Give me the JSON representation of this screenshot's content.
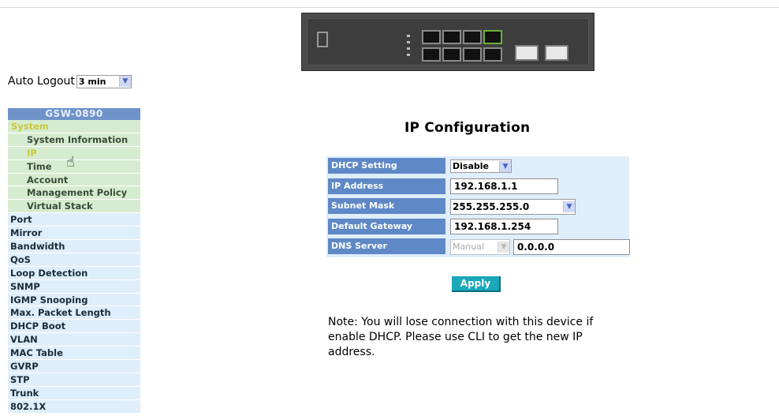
{
  "header": {
    "device_image": "switch-front-panel"
  },
  "auto_logout": {
    "label": "Auto Logout",
    "value": "3 min"
  },
  "sidebar": {
    "title": "GSW-0890",
    "items": [
      {
        "label": "System",
        "kind": "group"
      },
      {
        "label": "System Information",
        "kind": "sub"
      },
      {
        "label": "IP",
        "kind": "sub",
        "active": true
      },
      {
        "label": "Time",
        "kind": "sub"
      },
      {
        "label": "Account",
        "kind": "sub"
      },
      {
        "label": "Management Policy",
        "kind": "sub"
      },
      {
        "label": "Virtual Stack",
        "kind": "sub"
      },
      {
        "label": "Port",
        "kind": "top"
      },
      {
        "label": "Mirror",
        "kind": "top"
      },
      {
        "label": "Bandwidth",
        "kind": "top"
      },
      {
        "label": "QoS",
        "kind": "top"
      },
      {
        "label": "Loop Detection",
        "kind": "top"
      },
      {
        "label": "SNMP",
        "kind": "top"
      },
      {
        "label": "IGMP Snooping",
        "kind": "top"
      },
      {
        "label": "Max. Packet Length",
        "kind": "top"
      },
      {
        "label": "DHCP Boot",
        "kind": "top"
      },
      {
        "label": "VLAN",
        "kind": "top"
      },
      {
        "label": "MAC Table",
        "kind": "top"
      },
      {
        "label": "GVRP",
        "kind": "top"
      },
      {
        "label": "STP",
        "kind": "top"
      },
      {
        "label": "Trunk",
        "kind": "top"
      },
      {
        "label": "802.1X",
        "kind": "top"
      }
    ]
  },
  "main": {
    "title": "IP Configuration",
    "rows": {
      "dhcp": {
        "label": "DHCP Setting",
        "value": "Disable"
      },
      "ip": {
        "label": "IP Address",
        "value": "192.168.1.1"
      },
      "mask": {
        "label": "Subnet Mask",
        "value": "255.255.255.0"
      },
      "gateway": {
        "label": "Default Gateway",
        "value": "192.168.1.254"
      },
      "dns": {
        "label": "DNS Server",
        "mode": "Manual",
        "value": "0.0.0.0"
      }
    },
    "apply_label": "Apply",
    "note": "Note: You will lose connection with this device if enable DHCP. Please use CLI to get the new IP address."
  },
  "colors": {
    "sidebar_title_bg": "#6f92c9",
    "label_bg": "#5f88c6",
    "table_bg": "#dfeefb",
    "apply_bg": "#1aa7b8"
  }
}
